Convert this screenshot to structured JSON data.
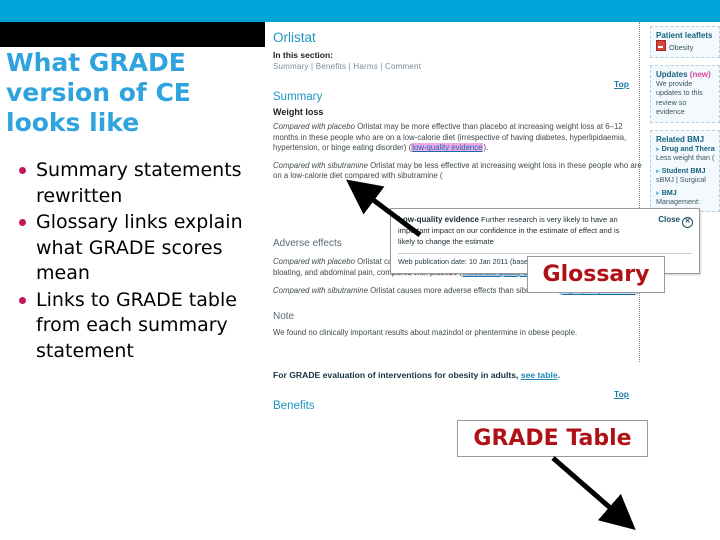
{
  "slide": {
    "title": "What GRADE version of CE looks like",
    "accent_cyan": "#00a4d8",
    "title_color": "#2ea3dd",
    "bullet_color": "#c2185b",
    "annotation_color": "#b01116",
    "bullets": [
      "Summary statements rewritten",
      "Glossary links explain what GRADE scores mean",
      "Links to GRADE table from each summary statement"
    ]
  },
  "annotations": {
    "glossary_label": "Glossary",
    "grade_table_label": "GRADE Table"
  },
  "screenshot": {
    "page_title": "Orlistat",
    "in_this_section_label": "In this section:",
    "section_links": "Summary | Benefits | Harms | Comment",
    "top_link": "Top",
    "summary_heading": "Summary",
    "weight_loss_heading": "Weight loss",
    "weight_loss_para_lead": "Compared with placebo",
    "weight_loss_para_body": " Orlistat may be more effective than placebo at increasing weight loss at 6–12 months in these people who are on a low-calorie diet (irrespective of having diabetes, hyperlipidaemia, hypertension, or binge eating disorder) (",
    "weight_loss_link": "low-quality evidence",
    "weight_loss_para_tail": ").",
    "sibutramine_para_lead": "Compared with sibutramine",
    "sibutramine_para_body": " Orlistat may be less effective at increasing weight loss in these people who are on a low-calorie diet compared with sibutramine (",
    "adverse_effects_heading": "Adverse effects",
    "adverse_para_lead": "Compared with placebo",
    "adverse_para_body": " Orlistat causes more adverse gastrointestinal effects such as diarrhoea, flatulence, bloating, and abdominal pain, compared with placebo (",
    "adverse_link": "moderate-quality evidence",
    "adverse_para_tail": ").",
    "adverse2_para_lead": "Compared with sibutramine",
    "adverse2_para_body": " Orlistat causes more adverse effects than sibutramine (",
    "adverse2_link": "high-quality evidence",
    "adverse2_para_tail": ")",
    "note_heading": "Note",
    "note_para": "We found no clinically important results about mazindol or phentermine in obese people.",
    "grade_line_text": "For GRADE evaluation of interventions for obesity in adults, ",
    "grade_line_link": "see table",
    "grade_line_tail": ".",
    "top_link2": "Top",
    "benefits_heading": "Benefits",
    "tooltip": {
      "term": "Low-quality evidence",
      "definition": " Further research is very likely to have an important impact on our confidence in the estimate of effect and is likely to change the estimate",
      "close_label": "Close",
      "footer": "Web publication date: 10 Jan 2011 (based on search)"
    },
    "rail": {
      "patient_heading": "Patient leaflets",
      "patient_item": "Obesity",
      "updates_heading": "Updates",
      "updates_new": "(new)",
      "updates_text": "We provide updates to this review so evidence",
      "related_heading": "Related BMJ",
      "related_items": [
        {
          "title": "Drug and Therapeutics",
          "sub": "Less weight than (Black triangle)"
        },
        {
          "title": "Student BMJ",
          "sub": "sBMJ | Surgical"
        },
        {
          "title": "BMJ",
          "sub": "Management:"
        }
      ]
    }
  }
}
